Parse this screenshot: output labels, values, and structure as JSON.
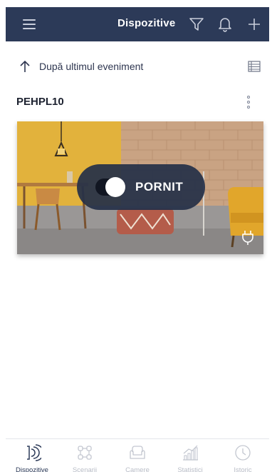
{
  "header": {
    "title": "Dispozitive",
    "icons": [
      "menu-icon",
      "filter-icon",
      "bell-icon",
      "plus-icon"
    ]
  },
  "sort": {
    "label": "După ultimul eveniment",
    "icons": [
      "arrow-up-icon",
      "list-view-icon"
    ]
  },
  "group": {
    "name": "PEHPL10"
  },
  "device": {
    "state_label": "PORNIT",
    "is_on": true,
    "type_icon": "plug-icon"
  },
  "tabs": [
    {
      "label": "Dispozitive",
      "icon": "devices-icon",
      "active": true
    },
    {
      "label": "Scenarii",
      "icon": "scenarios-icon",
      "active": false
    },
    {
      "label": "Camere",
      "icon": "rooms-icon",
      "active": false
    },
    {
      "label": "Statistici",
      "icon": "statistics-icon",
      "active": false
    },
    {
      "label": "Istoric",
      "icon": "history-icon",
      "active": false
    }
  ],
  "colors": {
    "header_bg": "#2c3a58",
    "text_dark": "#1d2230",
    "tab_inactive": "#b9bdc7",
    "pill_bg": "#263048"
  }
}
